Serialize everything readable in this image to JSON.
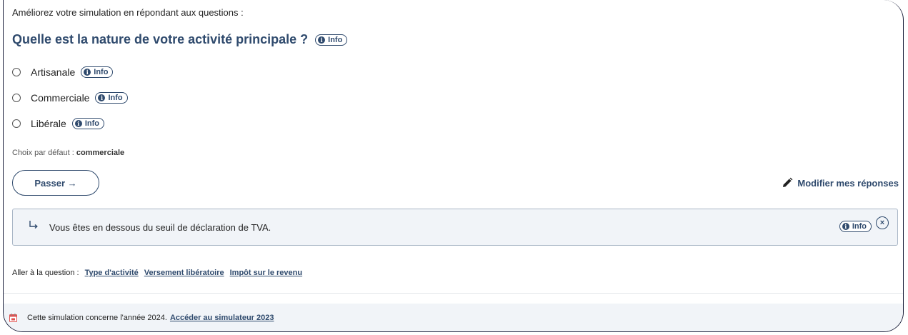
{
  "intro": "Améliorez votre simulation en répondant aux questions :",
  "question": {
    "title": "Quelle est la nature de votre activité principale ?",
    "info_label": "Info"
  },
  "options": [
    {
      "label": "Artisanale",
      "info_label": "Info"
    },
    {
      "label": "Commerciale",
      "info_label": "Info"
    },
    {
      "label": "Libérale",
      "info_label": "Info"
    }
  ],
  "default_choice": {
    "label": "Choix par défaut :",
    "value": "commerciale"
  },
  "actions": {
    "skip_label": "Passer →",
    "modify_label": "Modifier mes réponses"
  },
  "notice": {
    "text": "Vous êtes en dessous du seuil de déclaration de TVA.",
    "info_label": "Info",
    "close_symbol": "×"
  },
  "goto": {
    "label": "Aller à la question :",
    "links": [
      "Type d'activité",
      "Versement libératoire",
      "Impôt sur le revenu"
    ]
  },
  "footer": {
    "text": "Cette simulation concerne l'année 2024.",
    "link": "Accéder au simulateur 2023"
  },
  "colors": {
    "accent": "#2f4a6d",
    "notice_bg": "#f1f4f8",
    "calendar_red": "#e0504f"
  },
  "icons": {
    "info": "info-icon",
    "pencil": "pencil-icon",
    "arrow": "return-arrow-icon",
    "calendar": "calendar-icon"
  }
}
